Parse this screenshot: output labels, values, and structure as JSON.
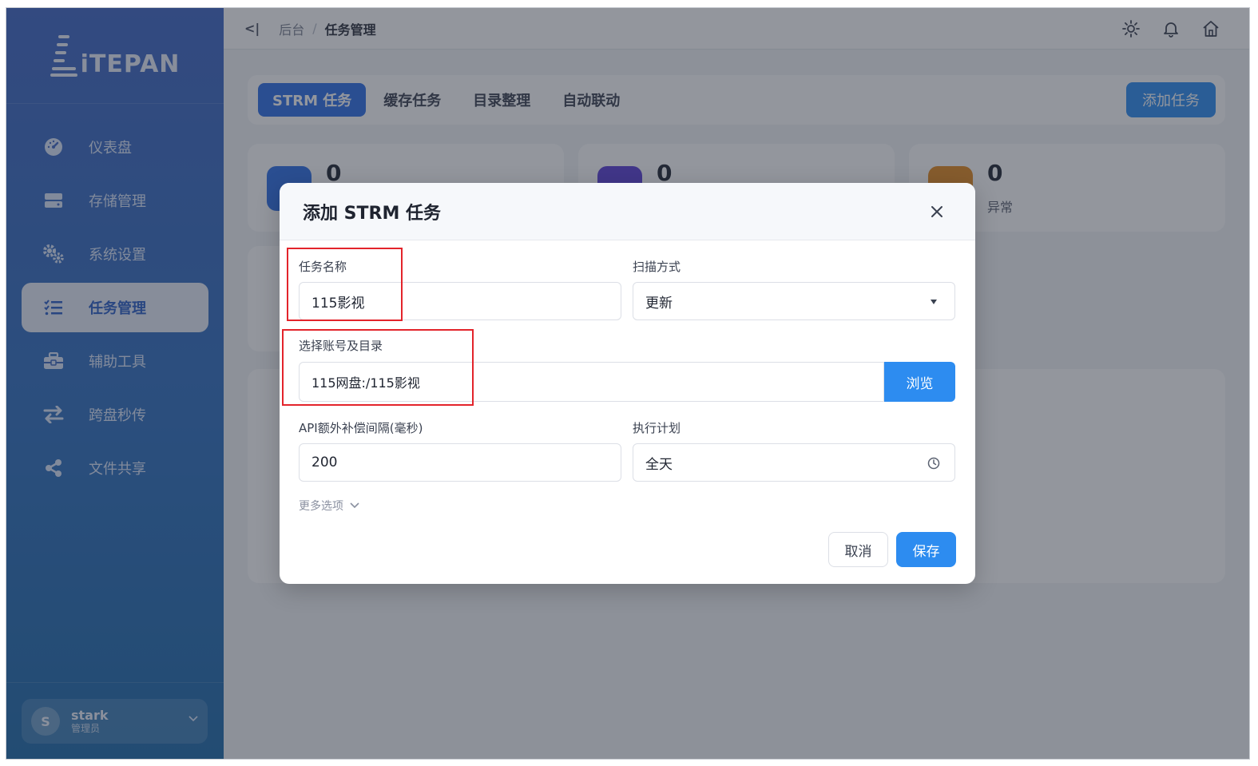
{
  "logo": {
    "text": "iTEPAN"
  },
  "sidebar": {
    "items": [
      {
        "label": "仪表盘",
        "icon": "dashboard-icon"
      },
      {
        "label": "存储管理",
        "icon": "storage-icon"
      },
      {
        "label": "系统设置",
        "icon": "gears-icon"
      },
      {
        "label": "任务管理",
        "icon": "task-list-icon",
        "active": true
      },
      {
        "label": "辅助工具",
        "icon": "toolbox-icon"
      },
      {
        "label": "跨盘秒传",
        "icon": "transfer-arrows-icon"
      },
      {
        "label": "文件共享",
        "icon": "share-icon"
      }
    ]
  },
  "user": {
    "avatar_letter": "S",
    "name": "stark",
    "role": "管理员"
  },
  "topbar": {
    "collapse_label": "<|",
    "breadcrumb": {
      "root": "后台",
      "separator": "/",
      "current": "任务管理"
    },
    "icons": [
      "sun-icon",
      "bell-icon",
      "home-icon"
    ]
  },
  "tabs": {
    "items": [
      "STRM 任务",
      "缓存任务",
      "目录整理",
      "自动联动"
    ],
    "active_index": 0,
    "add_label": "添加任务"
  },
  "stats": [
    {
      "value": "0",
      "label": "",
      "color": "#2d6fe6"
    },
    {
      "value": "0",
      "label": "",
      "color": "#5b3fd6"
    },
    {
      "value": "0",
      "label": "异常",
      "color": "#e58a1f"
    }
  ],
  "modal": {
    "title": "添加 STRM 任务",
    "task_name": {
      "label": "任务名称",
      "value": "115影视"
    },
    "scan_mode": {
      "label": "扫描方式",
      "value": "更新"
    },
    "account_dir": {
      "label": "选择账号及目录",
      "value": "115网盘:/115影视",
      "browse_label": "浏览"
    },
    "api_interval": {
      "label": "API额外补偿间隔(毫秒)",
      "value": "200"
    },
    "schedule": {
      "label": "执行计划",
      "value": "全天"
    },
    "more_options": "更多选项",
    "cancel_label": "取消",
    "save_label": "保存"
  },
  "colors": {
    "accent": "#2d8cf0",
    "highlight": "#e3242b"
  }
}
